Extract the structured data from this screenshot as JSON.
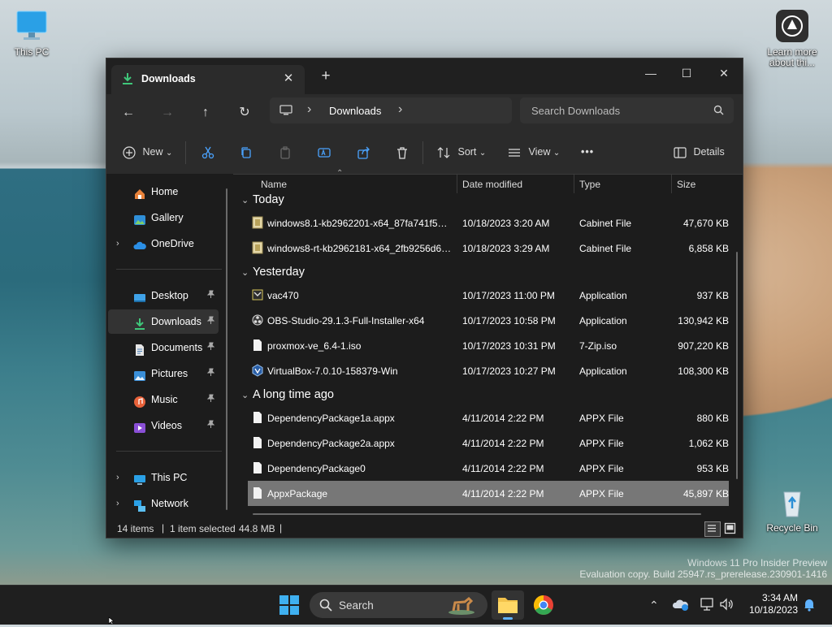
{
  "desktop": {
    "this_pc": "This PC",
    "learn_more": "Learn more about thi...",
    "recycle_bin": "Recycle Bin",
    "watermark_line1": "Windows 11 Pro Insider Preview",
    "watermark_line2": "Evaluation copy. Build 25947.rs_prerelease.230901-1416"
  },
  "window": {
    "tab_title": "Downloads",
    "tab_close": "✕",
    "new_tab": "+",
    "minimize": "—",
    "maximize": "☐",
    "close": "✕"
  },
  "address": {
    "back": "←",
    "forward": "→",
    "up": "↑",
    "refresh": "↻",
    "sep1": "›",
    "location": "Downloads",
    "sep2": "›",
    "search_placeholder": "Search Downloads"
  },
  "toolbar": {
    "new_label": "New",
    "sort_label": "Sort",
    "view_label": "View",
    "more_label": "•••",
    "details_label": "Details",
    "dropdown": "⌄"
  },
  "sidebar": {
    "items": [
      {
        "label": "Home"
      },
      {
        "label": "Gallery"
      },
      {
        "label": "OneDrive"
      },
      {
        "label": "Desktop"
      },
      {
        "label": "Downloads"
      },
      {
        "label": "Documents"
      },
      {
        "label": "Pictures"
      },
      {
        "label": "Music"
      },
      {
        "label": "Videos"
      },
      {
        "label": "This PC"
      },
      {
        "label": "Network"
      }
    ],
    "chevron": "›",
    "pin": "📌"
  },
  "columns": {
    "name": "Name",
    "date": "Date modified",
    "type": "Type",
    "size": "Size",
    "sort_chevron": "⌃"
  },
  "groups": {
    "today": "Today",
    "yesterday": "Yesterday",
    "long_ago": "A long time ago",
    "chevron": "⌄"
  },
  "files": [
    {
      "name": "windows8.1-kb2962201-x64_87fa741f5291...",
      "date": "10/18/2023 3:20 AM",
      "type": "Cabinet File",
      "size": "47,670 KB"
    },
    {
      "name": "windows8-rt-kb2962181-x64_2fb9256d6b...",
      "date": "10/18/2023 3:29 AM",
      "type": "Cabinet File",
      "size": "6,858 KB"
    },
    {
      "name": "vac470",
      "date": "10/17/2023 11:00 PM",
      "type": "Application",
      "size": "937 KB"
    },
    {
      "name": "OBS-Studio-29.1.3-Full-Installer-x64",
      "date": "10/17/2023 10:58 PM",
      "type": "Application",
      "size": "130,942 KB"
    },
    {
      "name": "proxmox-ve_6.4-1.iso",
      "date": "10/17/2023 10:31 PM",
      "type": "7-Zip.iso",
      "size": "907,220 KB"
    },
    {
      "name": "VirtualBox-7.0.10-158379-Win",
      "date": "10/17/2023 10:27 PM",
      "type": "Application",
      "size": "108,300 KB"
    },
    {
      "name": "DependencyPackage1a.appx",
      "date": "4/11/2014 2:22 PM",
      "type": "APPX File",
      "size": "880 KB"
    },
    {
      "name": "DependencyPackage2a.appx",
      "date": "4/11/2014 2:22 PM",
      "type": "APPX File",
      "size": "1,062 KB"
    },
    {
      "name": "DependencyPackage0",
      "date": "4/11/2014 2:22 PM",
      "type": "APPX File",
      "size": "953 KB"
    },
    {
      "name": "AppxPackage",
      "date": "4/11/2014 2:22 PM",
      "type": "APPX File",
      "size": "45,897 KB"
    }
  ],
  "status": {
    "count": "14 items",
    "sep": "|",
    "selected": "1 item selected",
    "size": "44.8 MB"
  },
  "taskbar": {
    "search_label": "Search",
    "tray_up": "⌃",
    "time": "3:34 AM",
    "date": "10/18/2023"
  },
  "colors": {
    "accent": "#0078d4",
    "folder": "#f2c24b",
    "selection": "#777777",
    "window_bg": "#1c1c1c"
  }
}
